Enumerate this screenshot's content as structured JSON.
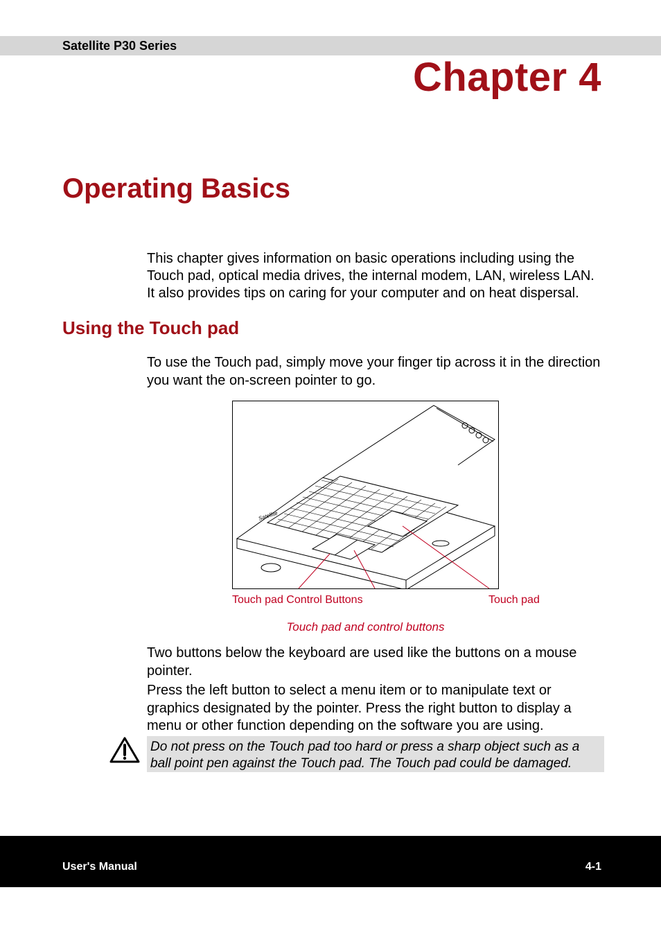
{
  "header": {
    "series": "Satellite P30 Series",
    "chapter": "Chapter 4"
  },
  "section": {
    "title": "Operating Basics",
    "intro": "This chapter gives information on basic operations including using the Touch pad, optical media drives, the internal modem, LAN, wireless LAN. It also provides tips on caring for your computer and on heat  dispersal."
  },
  "subsection": {
    "title": "Using the Touch pad",
    "para1": "To use the Touch pad, simply move your finger tip across it in the direction you want the on-screen pointer to go.",
    "figure": {
      "label_left": "Touch pad Control Buttons",
      "label_right": "Touch pad",
      "caption": "Touch pad and control buttons"
    },
    "para2": "Two buttons below the keyboard are used like the buttons on a mouse pointer.",
    "para3": "Press the left button to select a menu item or to manipulate text or graphics designated by the pointer. Press the right button to display a menu or other function depending on the software you are using."
  },
  "caution": {
    "text": "Do not press on the Touch pad too hard or press a sharp object such as a ball point pen against the Touch pad. The Touch pad could be damaged."
  },
  "footer": {
    "left": "User's Manual",
    "right": "4-1"
  },
  "colors": {
    "accent": "#a01018",
    "callout": "#c00020"
  }
}
